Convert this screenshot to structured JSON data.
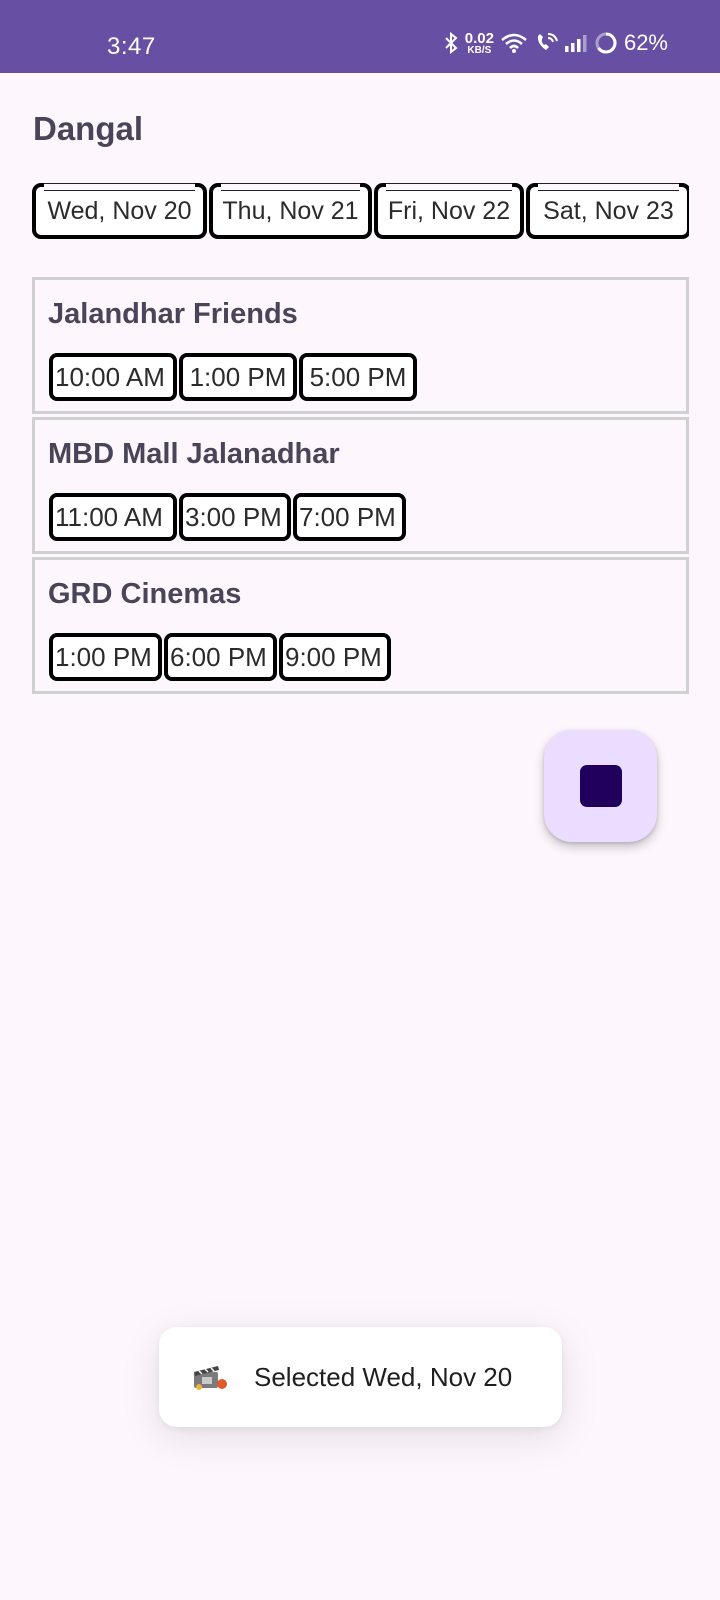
{
  "status_bar": {
    "time": "3:47",
    "net_speed_value": "0.02",
    "net_speed_unit": "KB/S",
    "battery_percent": "62%",
    "icons": [
      "bluetooth-icon",
      "wifi-icon",
      "wifi-calling-icon",
      "signal-icon",
      "battery-ring-icon"
    ],
    "background": "#6750a4"
  },
  "movie": {
    "title": "Dangal"
  },
  "dates": [
    {
      "label": "Wed, Nov 20"
    },
    {
      "label": "Thu, Nov 21"
    },
    {
      "label": "Fri, Nov 22"
    },
    {
      "label": "Sat, Nov 23"
    }
  ],
  "theatres": [
    {
      "name": "Jalandhar Friends",
      "times": [
        "10:00 AM",
        "1:00 PM",
        "5:00 PM"
      ]
    },
    {
      "name": "MBD Mall Jalanadhar",
      "times": [
        "11:00 AM",
        "3:00 PM",
        "7:00 PM"
      ]
    },
    {
      "name": "GRD Cinemas",
      "times": [
        "1:00 PM",
        "6:00 PM",
        "9:00 PM"
      ]
    }
  ],
  "fab": {
    "icon": "stop-square-icon",
    "background": "#eaddff",
    "icon_color": "#21005d"
  },
  "toast": {
    "icon": "movie-clapper-app-icon",
    "text": "Selected Wed, Nov 20"
  }
}
